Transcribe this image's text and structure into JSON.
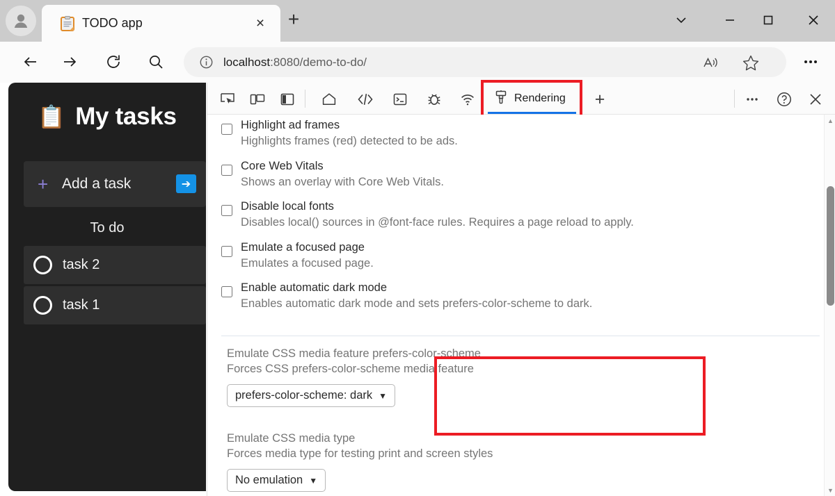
{
  "window": {
    "profile_icon": "person-avatar-icon",
    "controls": [
      {
        "name": "tab-actions-chevron",
        "glyph": "chevron-down-icon"
      },
      {
        "name": "minimize",
        "glyph": "minimize-icon"
      },
      {
        "name": "maximize",
        "glyph": "maximize-icon"
      },
      {
        "name": "close",
        "glyph": "close-icon"
      }
    ]
  },
  "tabstrip": {
    "tab": {
      "favicon": "clipboard-icon",
      "title": "TODO app",
      "close_label": "×"
    },
    "new_tab_label": "+"
  },
  "navbar": {
    "back_icon": "back-arrow-icon",
    "forward_icon": "forward-arrow-icon",
    "reload_icon": "reload-icon",
    "search_icon": "search-icon",
    "site_info_icon": "info-circle-icon",
    "url_host": "localhost",
    "url_path": ":8080/demo-to-do/",
    "read_aloud_icon": "read-aloud-icon",
    "favorite_icon": "star-icon",
    "more_icon": "ellipsis-icon"
  },
  "todo_app": {
    "emoji": "📋",
    "title": "My tasks",
    "add_task": {
      "plus": "+",
      "label": "Add a task",
      "submit_glyph": "➔"
    },
    "section_label": "To do",
    "tasks": [
      {
        "label": "task 2",
        "done": false
      },
      {
        "label": "task 1",
        "done": false
      }
    ]
  },
  "devtools": {
    "toolbar_icons": [
      {
        "name": "inspect-element-icon"
      },
      {
        "name": "device-emulation-icon"
      },
      {
        "name": "dock-side-icon"
      },
      {
        "name": "welcome-home-icon"
      },
      {
        "name": "elements-code-icon"
      },
      {
        "name": "console-icon"
      },
      {
        "name": "debugger-bug-icon"
      },
      {
        "name": "network-icon"
      }
    ],
    "active_tab": {
      "label": "Rendering",
      "icon": "paint-brush-icon"
    },
    "add_tool_label": "+",
    "right_icons": [
      {
        "name": "more-tools-ellipsis-icon"
      },
      {
        "name": "help-question-icon"
      },
      {
        "name": "close-devtools-icon"
      }
    ],
    "settings": [
      {
        "title": "Highlight ad frames",
        "description": "Highlights frames (red) detected to be ads.",
        "checked": false
      },
      {
        "title": "Core Web Vitals",
        "description": "Shows an overlay with Core Web Vitals.",
        "checked": false
      },
      {
        "title": "Disable local fonts",
        "description": "Disables local() sources in @font-face rules. Requires a page reload to apply.",
        "checked": false
      },
      {
        "title": "Emulate a focused page",
        "description": "Emulates a focused page.",
        "checked": false
      },
      {
        "title": "Enable automatic dark mode",
        "description": "Enables automatic dark mode and sets prefers-color-scheme to dark.",
        "checked": false
      }
    ],
    "media_feature": {
      "title": "Emulate CSS media feature prefers-color-scheme",
      "description": "Forces CSS prefers-color-scheme media feature",
      "selected": "prefers-color-scheme: dark",
      "caret": "▼"
    },
    "media_type": {
      "title": "Emulate CSS media type",
      "description": "Forces media type for testing print and screen styles",
      "selected": "No emulation",
      "caret": "▼"
    },
    "scrollbar": {
      "up": "▲",
      "down": "▼"
    }
  },
  "annotations": {
    "highlight_color": "#ec1c24",
    "boxes": [
      {
        "name": "rendering-tab-highlight"
      },
      {
        "name": "prefers-color-scheme-highlight"
      }
    ]
  },
  "colors": {
    "accent_blue": "#1473e6",
    "titlebar": "#cccccc",
    "chrome": "#fbfbfb",
    "app_dark_bg": "#1f1f1f",
    "app_card": "#2f2f2f",
    "plus_purple": "#8b7fd4",
    "go_blue": "#1492e6"
  }
}
